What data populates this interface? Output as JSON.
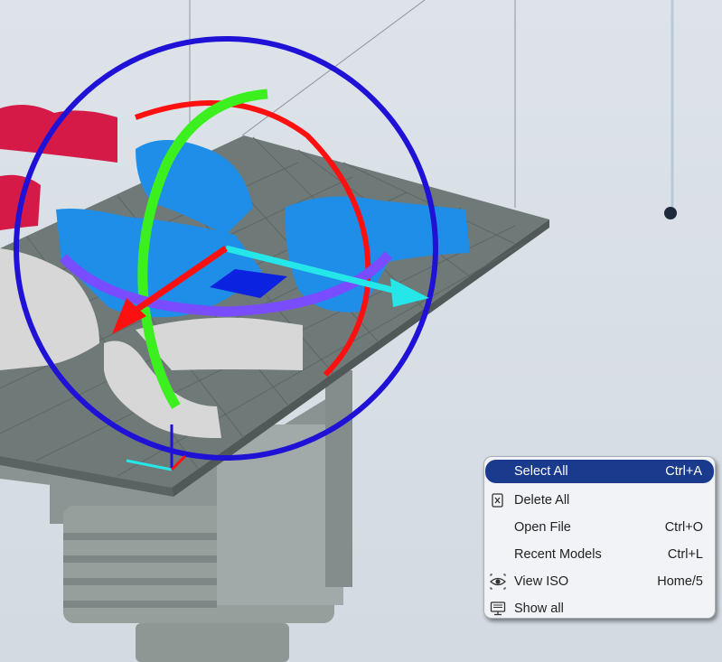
{
  "viewport": {
    "scene": "3d-build-plate-with-dental-models"
  },
  "colors": {
    "background": "#d7dee5",
    "plate": "#6f7a78",
    "selected_model": "#1e8ee8",
    "red_model": "#d61a48",
    "gray_model": "#d7d7d7",
    "gizmo_sphere": "#1f12d6",
    "gizmo_red": "#ff1010",
    "gizmo_green": "#3cf020",
    "gizmo_purple": "#7a4cff",
    "gizmo_cyan": "#25e6e8",
    "menu_highlight": "#1a3a8e",
    "slider_knob": "#1c2a3c"
  },
  "context_menu": {
    "items": [
      {
        "label": "Select All",
        "shortcut": "Ctrl+A",
        "icon": "",
        "highlighted": true
      },
      {
        "label": "Delete All",
        "shortcut": "",
        "icon": "delete-icon",
        "highlighted": false
      },
      {
        "label": "Open File",
        "shortcut": "Ctrl+O",
        "icon": "",
        "highlighted": false
      },
      {
        "label": "Recent Models",
        "shortcut": "Ctrl+L",
        "icon": "",
        "highlighted": false
      },
      {
        "label": "View ISO",
        "shortcut": "Home/5",
        "icon": "eye-icon",
        "highlighted": false
      },
      {
        "label": "Show all",
        "shortcut": "",
        "icon": "monitor-icon",
        "highlighted": false
      }
    ]
  }
}
